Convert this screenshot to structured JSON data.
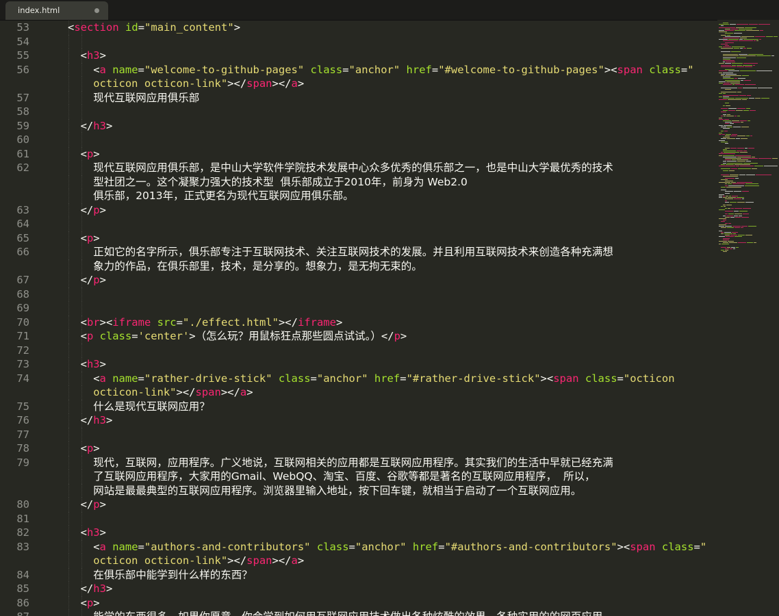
{
  "tab": {
    "title": "index.html"
  },
  "colors": {
    "background": "#272822",
    "tag": "#f92672",
    "attribute": "#a6e22e",
    "string": "#e6db74",
    "text": "#f8f8f2",
    "gutter": "#8f908a"
  },
  "lines": [
    {
      "num": "53",
      "indent": 1,
      "tokens": [
        [
          "pun",
          "<"
        ],
        [
          "tag",
          "section"
        ],
        [
          "pun",
          " "
        ],
        [
          "attr",
          "id"
        ],
        [
          "pun",
          "="
        ],
        [
          "str",
          "\"main_content\""
        ],
        [
          "pun",
          ">"
        ]
      ]
    },
    {
      "num": "54",
      "indent": 0,
      "tokens": []
    },
    {
      "num": "55",
      "indent": 2,
      "tokens": [
        [
          "pun",
          "<"
        ],
        [
          "tag",
          "h3"
        ],
        [
          "pun",
          ">"
        ]
      ]
    },
    {
      "num": "56",
      "indent": 3,
      "tokens": [
        [
          "pun",
          "<"
        ],
        [
          "tag",
          "a"
        ],
        [
          "pun",
          " "
        ],
        [
          "attr",
          "name"
        ],
        [
          "pun",
          "="
        ],
        [
          "str",
          "\"welcome-to-github-pages\""
        ],
        [
          "pun",
          " "
        ],
        [
          "attr",
          "class"
        ],
        [
          "pun",
          "="
        ],
        [
          "str",
          "\"anchor\""
        ],
        [
          "pun",
          " "
        ],
        [
          "attr",
          "href"
        ],
        [
          "pun",
          "="
        ],
        [
          "str",
          "\"#welcome-to-github-pages\""
        ],
        [
          "pun",
          "><"
        ],
        [
          "tag",
          "span"
        ],
        [
          "pun",
          " "
        ],
        [
          "attr",
          "class"
        ],
        [
          "pun",
          "="
        ],
        [
          "str",
          "\""
        ]
      ]
    },
    {
      "num": "",
      "indent": 3,
      "tokens": [
        [
          "str",
          "octicon octicon-link\""
        ],
        [
          "pun",
          "></"
        ],
        [
          "tag",
          "span"
        ],
        [
          "pun",
          "></"
        ],
        [
          "tag",
          "a"
        ],
        [
          "pun",
          ">"
        ]
      ]
    },
    {
      "num": "57",
      "indent": 3,
      "tokens": [
        [
          "cjk",
          "现代互联网应用俱乐部"
        ]
      ]
    },
    {
      "num": "58",
      "indent": 0,
      "tokens": []
    },
    {
      "num": "59",
      "indent": 2,
      "tokens": [
        [
          "pun",
          "</"
        ],
        [
          "tag",
          "h3"
        ],
        [
          "pun",
          ">"
        ]
      ]
    },
    {
      "num": "60",
      "indent": 0,
      "tokens": []
    },
    {
      "num": "61",
      "indent": 2,
      "tokens": [
        [
          "pun",
          "<"
        ],
        [
          "tag",
          "p"
        ],
        [
          "pun",
          ">"
        ]
      ]
    },
    {
      "num": "62",
      "indent": 3,
      "tokens": [
        [
          "cjk",
          "现代互联网应用俱乐部，是中山大学软件学院技术发展中心众多优秀的俱乐部之一，也是中山大学最优秀的技术"
        ]
      ]
    },
    {
      "num": "",
      "indent": 3,
      "tokens": [
        [
          "cjk",
          "型社团之一。这个凝聚力强大的技术型  俱乐部成立于2010年，前身为 Web2.0"
        ]
      ]
    },
    {
      "num": "",
      "indent": 3,
      "tokens": [
        [
          "cjk",
          "俱乐部，2013年，正式更名为现代互联网应用俱乐部。"
        ]
      ]
    },
    {
      "num": "63",
      "indent": 2,
      "tokens": [
        [
          "pun",
          "</"
        ],
        [
          "tag",
          "p"
        ],
        [
          "pun",
          ">"
        ]
      ]
    },
    {
      "num": "64",
      "indent": 0,
      "tokens": []
    },
    {
      "num": "65",
      "indent": 2,
      "tokens": [
        [
          "pun",
          "<"
        ],
        [
          "tag",
          "p"
        ],
        [
          "pun",
          ">"
        ]
      ]
    },
    {
      "num": "66",
      "indent": 3,
      "tokens": [
        [
          "cjk",
          "正如它的名字所示，俱乐部专注于互联网技术、关注互联网技术的发展。并且利用互联网技术来创造各种充满想"
        ]
      ]
    },
    {
      "num": "",
      "indent": 3,
      "tokens": [
        [
          "cjk",
          "象力的作品，在俱乐部里，技术，是分享的。想象力，是无拘无束的。"
        ]
      ]
    },
    {
      "num": "67",
      "indent": 2,
      "tokens": [
        [
          "pun",
          "</"
        ],
        [
          "tag",
          "p"
        ],
        [
          "pun",
          ">"
        ]
      ]
    },
    {
      "num": "68",
      "indent": 0,
      "tokens": []
    },
    {
      "num": "69",
      "indent": 0,
      "tokens": []
    },
    {
      "num": "70",
      "indent": 2,
      "tokens": [
        [
          "pun",
          "<"
        ],
        [
          "tag",
          "br"
        ],
        [
          "pun",
          "><"
        ],
        [
          "tag",
          "iframe"
        ],
        [
          "pun",
          " "
        ],
        [
          "attr",
          "src"
        ],
        [
          "pun",
          "="
        ],
        [
          "str",
          "\"./effect.html\""
        ],
        [
          "pun",
          "></"
        ],
        [
          "tag",
          "iframe"
        ],
        [
          "pun",
          ">"
        ]
      ]
    },
    {
      "num": "71",
      "indent": 2,
      "tokens": [
        [
          "pun",
          "<"
        ],
        [
          "tag",
          "p"
        ],
        [
          "pun",
          " "
        ],
        [
          "attr",
          "class"
        ],
        [
          "pun",
          "="
        ],
        [
          "str",
          "'center'"
        ],
        [
          "pun",
          ">"
        ],
        [
          "cjk",
          "（怎么玩？用鼠标狂点那些圆点试试。）"
        ],
        [
          "pun",
          "</"
        ],
        [
          "tag",
          "p"
        ],
        [
          "pun",
          ">"
        ]
      ]
    },
    {
      "num": "72",
      "indent": 0,
      "tokens": []
    },
    {
      "num": "73",
      "indent": 2,
      "tokens": [
        [
          "pun",
          "<"
        ],
        [
          "tag",
          "h3"
        ],
        [
          "pun",
          ">"
        ]
      ]
    },
    {
      "num": "74",
      "indent": 3,
      "tokens": [
        [
          "pun",
          "<"
        ],
        [
          "tag",
          "a"
        ],
        [
          "pun",
          " "
        ],
        [
          "attr",
          "name"
        ],
        [
          "pun",
          "="
        ],
        [
          "str",
          "\"rather-drive-stick\""
        ],
        [
          "pun",
          " "
        ],
        [
          "attr",
          "class"
        ],
        [
          "pun",
          "="
        ],
        [
          "str",
          "\"anchor\""
        ],
        [
          "pun",
          " "
        ],
        [
          "attr",
          "href"
        ],
        [
          "pun",
          "="
        ],
        [
          "str",
          "\"#rather-drive-stick\""
        ],
        [
          "pun",
          "><"
        ],
        [
          "tag",
          "span"
        ],
        [
          "pun",
          " "
        ],
        [
          "attr",
          "class"
        ],
        [
          "pun",
          "="
        ],
        [
          "str",
          "\"octicon"
        ]
      ]
    },
    {
      "num": "",
      "indent": 3,
      "tokens": [
        [
          "str",
          "octicon-link\""
        ],
        [
          "pun",
          "></"
        ],
        [
          "tag",
          "span"
        ],
        [
          "pun",
          "></"
        ],
        [
          "tag",
          "a"
        ],
        [
          "pun",
          ">"
        ]
      ]
    },
    {
      "num": "75",
      "indent": 3,
      "tokens": [
        [
          "cjk",
          "什么是现代互联网应用？"
        ]
      ]
    },
    {
      "num": "76",
      "indent": 2,
      "tokens": [
        [
          "pun",
          "</"
        ],
        [
          "tag",
          "h3"
        ],
        [
          "pun",
          ">"
        ]
      ]
    },
    {
      "num": "77",
      "indent": 0,
      "tokens": []
    },
    {
      "num": "78",
      "indent": 2,
      "tokens": [
        [
          "pun",
          "<"
        ],
        [
          "tag",
          "p"
        ],
        [
          "pun",
          ">"
        ]
      ]
    },
    {
      "num": "79",
      "indent": 3,
      "tokens": [
        [
          "cjk",
          "现代，互联网，应用程序。广义地说，互联网相关的应用都是互联网应用程序。其实我们的生活中早就已经充满"
        ]
      ]
    },
    {
      "num": "",
      "indent": 3,
      "tokens": [
        [
          "cjk",
          "了互联网应用程序，大家用的Gmail、WebQQ、淘宝、百度、谷歌等都是著名的互联网应用程序，  所以，"
        ]
      ]
    },
    {
      "num": "",
      "indent": 3,
      "tokens": [
        [
          "cjk",
          "网站是最最典型的互联网应用程序。浏览器里输入地址，按下回车键，就相当于启动了一个互联网应用。"
        ]
      ]
    },
    {
      "num": "80",
      "indent": 2,
      "tokens": [
        [
          "pun",
          "</"
        ],
        [
          "tag",
          "p"
        ],
        [
          "pun",
          ">"
        ]
      ]
    },
    {
      "num": "81",
      "indent": 0,
      "tokens": []
    },
    {
      "num": "82",
      "indent": 2,
      "tokens": [
        [
          "pun",
          "<"
        ],
        [
          "tag",
          "h3"
        ],
        [
          "pun",
          ">"
        ]
      ]
    },
    {
      "num": "83",
      "indent": 3,
      "tokens": [
        [
          "pun",
          "<"
        ],
        [
          "tag",
          "a"
        ],
        [
          "pun",
          " "
        ],
        [
          "attr",
          "name"
        ],
        [
          "pun",
          "="
        ],
        [
          "str",
          "\"authors-and-contributors\""
        ],
        [
          "pun",
          " "
        ],
        [
          "attr",
          "class"
        ],
        [
          "pun",
          "="
        ],
        [
          "str",
          "\"anchor\""
        ],
        [
          "pun",
          " "
        ],
        [
          "attr",
          "href"
        ],
        [
          "pun",
          "="
        ],
        [
          "str",
          "\"#authors-and-contributors\""
        ],
        [
          "pun",
          "><"
        ],
        [
          "tag",
          "span"
        ],
        [
          "pun",
          " "
        ],
        [
          "attr",
          "class"
        ],
        [
          "pun",
          "="
        ],
        [
          "str",
          "\""
        ]
      ]
    },
    {
      "num": "",
      "indent": 3,
      "tokens": [
        [
          "str",
          "octicon octicon-link\""
        ],
        [
          "pun",
          "></"
        ],
        [
          "tag",
          "span"
        ],
        [
          "pun",
          "></"
        ],
        [
          "tag",
          "a"
        ],
        [
          "pun",
          ">"
        ]
      ]
    },
    {
      "num": "84",
      "indent": 3,
      "tokens": [
        [
          "cjk",
          "在俱乐部中能学到什么样的东西？"
        ]
      ]
    },
    {
      "num": "85",
      "indent": 2,
      "tokens": [
        [
          "pun",
          "</"
        ],
        [
          "tag",
          "h3"
        ],
        [
          "pun",
          ">"
        ]
      ]
    },
    {
      "num": "86",
      "indent": 2,
      "tokens": [
        [
          "pun",
          "<"
        ],
        [
          "tag",
          "p"
        ],
        [
          "pun",
          ">"
        ]
      ]
    },
    {
      "num": "87",
      "indent": 3,
      "tokens": [
        [
          "cjk",
          "能学的东西很多，如果你愿意，你会学到如何用互联网应用技术做出各种炫酷的效果，各种实用的的网页应用"
        ]
      ]
    }
  ]
}
